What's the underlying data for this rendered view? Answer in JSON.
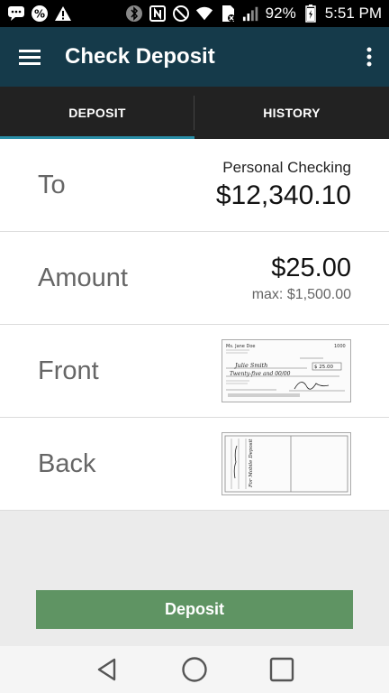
{
  "status_bar": {
    "battery": "92%",
    "time": "5:51 PM",
    "icons": [
      "chat-icon",
      "percent-icon",
      "warning-icon",
      "bluetooth-icon",
      "nfc-icon",
      "mute-icon",
      "wifi-icon",
      "sim-icon",
      "signal-icon",
      "battery-icon"
    ]
  },
  "app_bar": {
    "title": "Check Deposit",
    "icons": [
      "hamburger-menu-icon",
      "overflow-menu-icon"
    ]
  },
  "tabs": [
    {
      "label": "DEPOSIT",
      "active": true
    },
    {
      "label": "HISTORY",
      "active": false
    }
  ],
  "form": {
    "to": {
      "label": "To",
      "account": "Personal Checking",
      "balance": "$12,340.10"
    },
    "amount": {
      "label": "Amount",
      "value": "$25.00",
      "max": "max: $1,500.00"
    },
    "front": {
      "label": "Front"
    },
    "back": {
      "label": "Back"
    }
  },
  "check_front": {
    "name": "Ms. Jane Doe",
    "number": "1000",
    "payee": "Julie Smith",
    "amount": "$ 25.00",
    "written": "Twenty-five and 00/00"
  },
  "check_back": {
    "endorsement": "For Mobile Deposit"
  },
  "actions": {
    "deposit_label": "Deposit"
  },
  "nav_bar": {
    "icons": [
      "back-icon",
      "home-icon",
      "recents-icon"
    ]
  },
  "colors": {
    "app_bar": "#153a4a",
    "tab_indicator": "#2a8fa8",
    "deposit_button": "#5f9463"
  }
}
